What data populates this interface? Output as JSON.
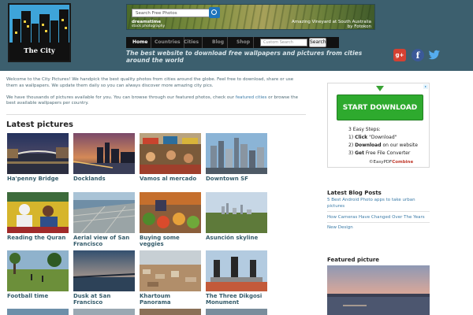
{
  "logo": {
    "name": "The City Pictures"
  },
  "banner": {
    "search_placeholder": "Search Free Photos",
    "brand": "dreamstime",
    "brand_sub": "stock photography",
    "caption": "Amazing Vineyard at South Australia",
    "caption_credit": "by Fotokon"
  },
  "nav": {
    "items": [
      "Home",
      "Countries",
      "Cities",
      "Blog",
      "Shop"
    ],
    "search_placeholder": "Custom Search",
    "search_button": "Search"
  },
  "tagline": "The best website to download free wallpapers and pictures from cities around the world",
  "social": {
    "gplus": "g+",
    "facebook": "f",
    "twitter": "twitter"
  },
  "intro": {
    "p1": "Welcome to the City Pictures! We handpick the best quality photos from cities around the globe. Feel free to download, share or use them as wallpapers. We update them daily so you can always discover more amazing city pics.",
    "p2_before": "We have thousands of pictures available for you. You can browse through our featured photos, check our ",
    "p2_link": "featured cities",
    "p2_after": " or browse the best available wallpapers per country."
  },
  "latest": {
    "heading": "Latest pictures",
    "items": [
      "Ha'penny Bridge",
      "Docklands",
      "Vamos al mercado",
      "Downtown SF",
      "Reading the Quran",
      "Aerial view of San Francisco",
      "Buying some veggies",
      "Asunción skyline",
      "Football time",
      "Dusk at San Francisco",
      "Khartoum Panorama",
      "The Three Dikgosi Monument"
    ]
  },
  "ad": {
    "button": "START DOWNLOAD",
    "steps_title": "3 Easy Steps:",
    "step1_pre": "1) ",
    "step1_bold": "Click",
    "step1_post": " \"Download\"",
    "step2_pre": "2) ",
    "step2_bold": "Download",
    "step2_post": " on our website",
    "step3_pre": "3) ",
    "step3_bold": "Get",
    "step3_post": " Free File Converter",
    "brand_pre": "©EasyPDF",
    "brand_bold": "Combine"
  },
  "blog": {
    "heading": "Latest Blog Posts",
    "posts": [
      "5 Best Android Photo apps to take urban pictures",
      "How Cameras Have Changed Over The Years",
      "New Design"
    ]
  },
  "featured": {
    "heading": "Featured picture"
  },
  "colors": {
    "header": "#3c5f6e",
    "link": "#3c7ca8",
    "thumb_label": "#355c6b",
    "ad_button": "#2eaa2e"
  }
}
